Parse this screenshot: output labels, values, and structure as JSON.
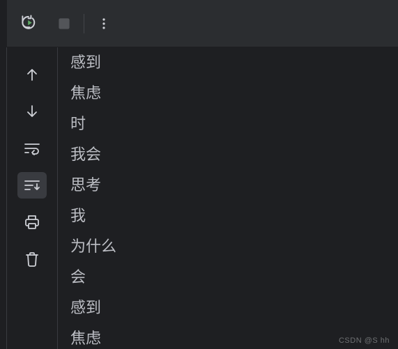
{
  "toolbar": {
    "rerun_icon": "rerun-icon",
    "stop_icon": "stop-icon",
    "more_icon": "more-vertical-icon"
  },
  "gutter": {
    "items": [
      {
        "name": "arrow-up-icon",
        "selected": false
      },
      {
        "name": "arrow-down-icon",
        "selected": false
      },
      {
        "name": "soft-wrap-icon",
        "selected": false
      },
      {
        "name": "scroll-end-icon",
        "selected": true
      },
      {
        "name": "print-icon",
        "selected": false
      },
      {
        "name": "trash-icon",
        "selected": false
      }
    ]
  },
  "output": {
    "lines": [
      "感到",
      "焦虑",
      "时",
      "我会",
      "思考",
      "我",
      "为什么",
      "会",
      "感到",
      "焦虑"
    ]
  },
  "watermark": "CSDN @S  hh"
}
